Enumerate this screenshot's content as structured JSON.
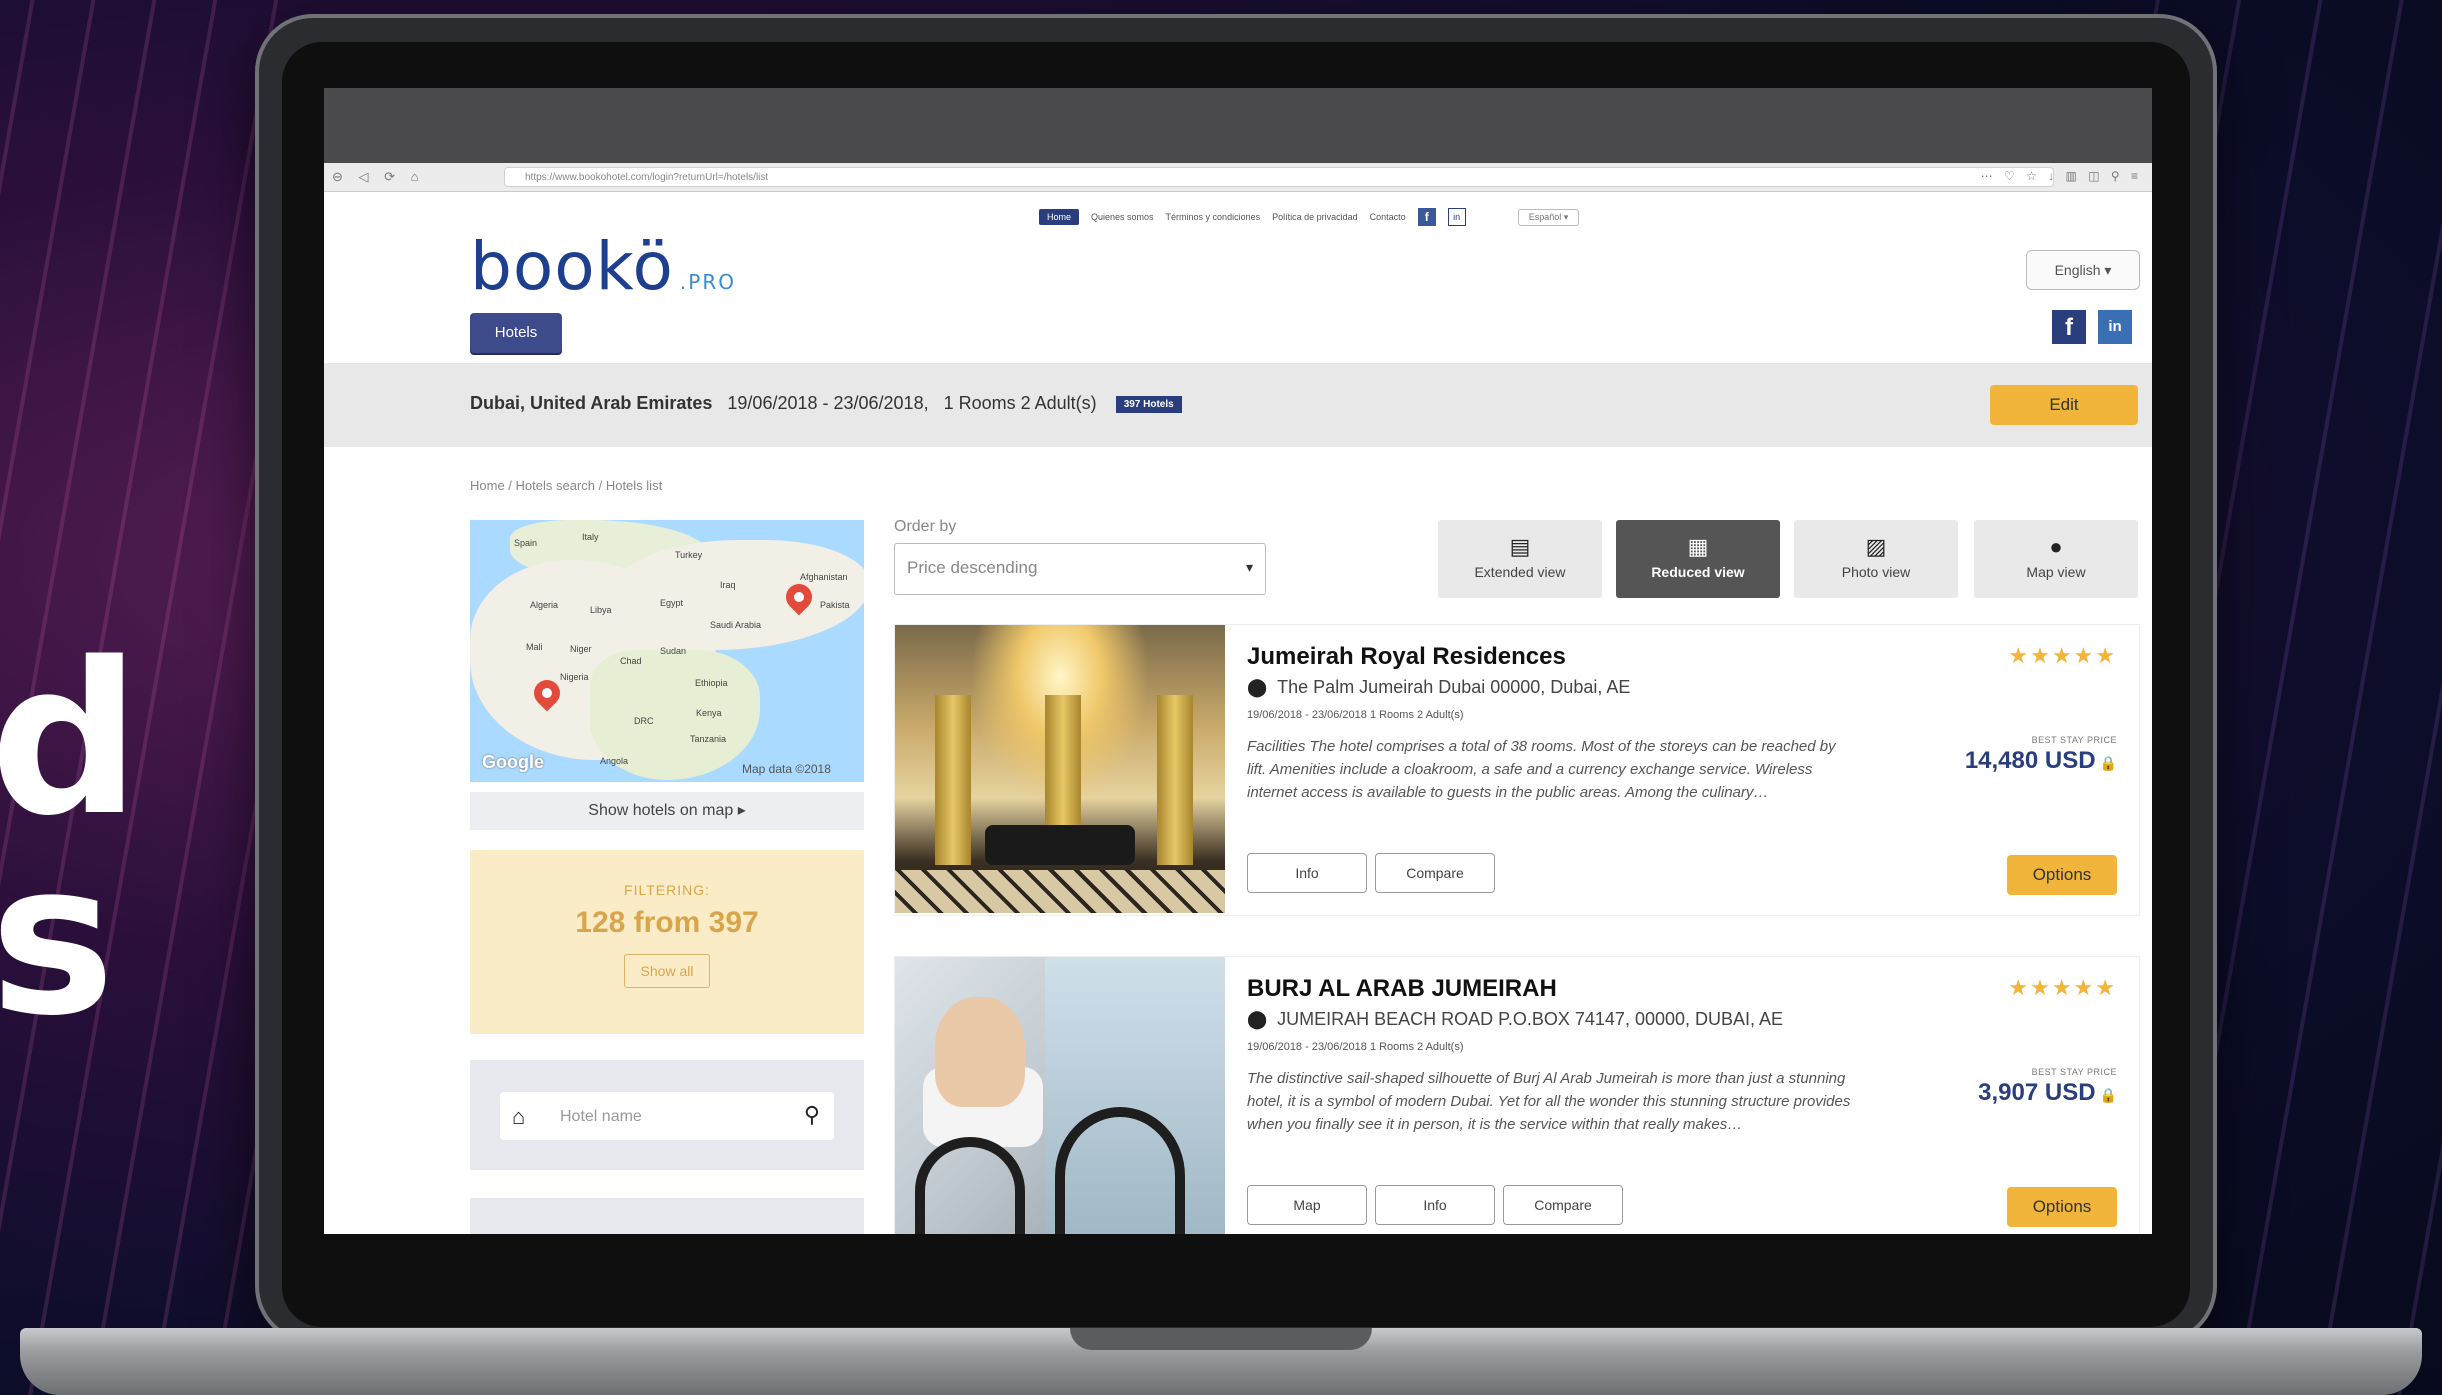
{
  "background": {
    "big_letters": [
      "d",
      "s"
    ],
    "accent_color": "#5a1f55"
  },
  "browser": {
    "nav_buttons": "⊖ ◁ ⟳ ⌂",
    "url": "https://www.bookohotel.com/login?returnUrl=/hotels/list",
    "right_icons": "⋯ ♡ ☆   ↓ ▥ ◫ ⚲ ≡"
  },
  "brand": {
    "name": "bookö",
    "suffix": ".PRO",
    "color": "#1e3f8f"
  },
  "top_nav": {
    "items": [
      "Home",
      "Quienes somos",
      "Términos y condiciones",
      "Política de privacidad",
      "Contacto"
    ],
    "language_small": "Español ▾"
  },
  "tabs": {
    "hotels": "Hotels"
  },
  "language": {
    "selected": "English ▾"
  },
  "social": {
    "facebook": "f",
    "linkedin": "in"
  },
  "search_summary": {
    "location": "Dubai, United Arab Emirates",
    "dates": "19/06/2018 - 23/06/2018,",
    "rooms": "1 Rooms 2 Adult(s)",
    "badge": "397 Hotels",
    "edit_label": "Edit"
  },
  "breadcrumb": "Home  /  Hotels search  /  Hotels list",
  "map": {
    "labels": [
      {
        "text": "Spain",
        "cls": "l-spain"
      },
      {
        "text": "Italy",
        "cls": "l-italy"
      },
      {
        "text": "Turkey",
        "cls": "l-turkey"
      },
      {
        "text": "Iraq",
        "cls": "l-iraq"
      },
      {
        "text": "Afghanistan",
        "cls": "l-afg"
      },
      {
        "text": "Algeria",
        "cls": "l-algeria"
      },
      {
        "text": "Libya",
        "cls": "l-libya"
      },
      {
        "text": "Egypt",
        "cls": "l-egypt"
      },
      {
        "text": "Saudi Arabia",
        "cls": "l-saudi"
      },
      {
        "text": "Pakista",
        "cls": "l-pak"
      },
      {
        "text": "Mali",
        "cls": "l-mali"
      },
      {
        "text": "Niger",
        "cls": "l-niger"
      },
      {
        "text": "Chad",
        "cls": "l-chad"
      },
      {
        "text": "Sudan",
        "cls": "l-sudan"
      },
      {
        "text": "Nigeria",
        "cls": "l-nigeria"
      },
      {
        "text": "Ethiopia",
        "cls": "l-ethiopia"
      },
      {
        "text": "Kenya",
        "cls": "l-kenya"
      },
      {
        "text": "DRC",
        "cls": "l-drc"
      },
      {
        "text": "Tanzania",
        "cls": "l-tanzania"
      },
      {
        "text": "Angola",
        "cls": "l-angola"
      }
    ],
    "google": "Google",
    "map_data": "Map data ©2018",
    "show_on_map": "Show hotels on map ▸"
  },
  "filtering": {
    "label": "FILTERING:",
    "count": "128 from 397",
    "show_all": "Show all"
  },
  "hotel_name_search": {
    "placeholder": "Hotel name"
  },
  "order": {
    "label": "Order by",
    "selected": "Price descending"
  },
  "views": [
    {
      "label": "Extended view",
      "icon": "▤",
      "active": false
    },
    {
      "label": "Reduced view",
      "icon": "▦",
      "active": true
    },
    {
      "label": "Photo view",
      "icon": "▨",
      "active": false
    },
    {
      "label": "Map view",
      "icon": "●",
      "active": false
    }
  ],
  "hotels": [
    {
      "name": "Jumeirah Royal Residences",
      "address": "The Palm Jumeirah Dubai 00000, Dubai, AE",
      "dates": "19/06/2018 - 23/06/2018 1 Rooms 2 Adult(s)",
      "description": "Facilities The hotel comprises a total of 38 rooms. Most of the storeys can be reached by lift. Amenities include a cloakroom, a safe and a currency exchange service. Wireless internet access is available to guests in the public areas. Among the culinary…",
      "buttons": [
        "Info",
        "Compare"
      ],
      "stars": 5,
      "best_stay_label": "BEST STAY PRICE",
      "price": "14,480 USD",
      "options_label": "Options"
    },
    {
      "name": "BURJ AL ARAB JUMEIRAH",
      "address": "JUMEIRAH BEACH ROAD P.O.BOX 74147, 00000, DUBAI, AE",
      "dates": "19/06/2018 - 23/06/2018 1 Rooms 2 Adult(s)",
      "description": "The distinctive sail-shaped silhouette of Burj Al Arab Jumeirah is more than just a stunning hotel, it is a symbol of modern Dubai. Yet for all the wonder this stunning structure provides when you finally see it in person, it is the service within that really makes…",
      "buttons": [
        "Map",
        "Info",
        "Compare"
      ],
      "stars": 5,
      "best_stay_label": "BEST STAY PRICE",
      "price": "3,907 USD",
      "options_label": "Options"
    }
  ]
}
